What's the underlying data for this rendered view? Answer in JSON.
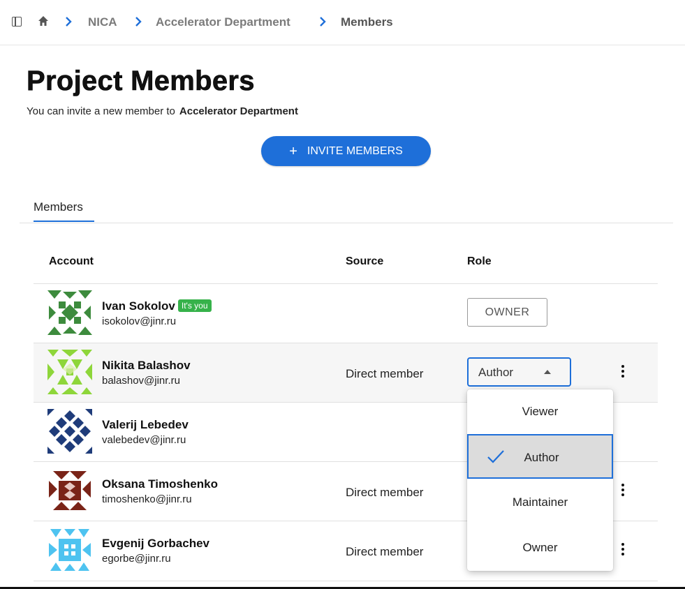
{
  "breadcrumb": {
    "items": [
      "NICA",
      "Accelerator Department",
      "Members"
    ]
  },
  "page": {
    "title": "Project Members",
    "subtitle_prefix": "You can invite a new member to",
    "subtitle_group": "Accelerator Department",
    "invite_plus": "+",
    "invite_label": "INVITE MEMBERS"
  },
  "tabs": [
    {
      "label": "Members"
    }
  ],
  "table": {
    "headers": {
      "account": "Account",
      "source": "Source",
      "role": "Role"
    },
    "rows": [
      {
        "name": "Ivan Sokolov",
        "badge": "It's you",
        "email": "isokolov@jinr.ru",
        "source": "",
        "role": "OWNER",
        "avatar_color": "#3d8b3d"
      },
      {
        "name": "Nikita Balashov",
        "email": "balashov@jinr.ru",
        "source": "Direct member",
        "role": "Author",
        "avatar_color": "#8ed63a"
      },
      {
        "name": "Valerij Lebedev",
        "email": "valebedev@jinr.ru",
        "source": "",
        "role": "",
        "avatar_color": "#1f3c7a"
      },
      {
        "name": "Oksana Timoshenko",
        "email": "timoshenko@jinr.ru",
        "source": "Direct member",
        "role": "",
        "avatar_color": "#7a2418"
      },
      {
        "name": "Evgenij Gorbachev",
        "email": "egorbe@jinr.ru",
        "source": "Direct member",
        "role": "",
        "avatar_color": "#4ec3f0"
      }
    ]
  },
  "role_menu": {
    "options": [
      "Viewer",
      "Author",
      "Maintainer",
      "Owner"
    ],
    "selected": "Author"
  },
  "colors": {
    "accent": "#1e6fd9",
    "badge": "#36b24a"
  }
}
